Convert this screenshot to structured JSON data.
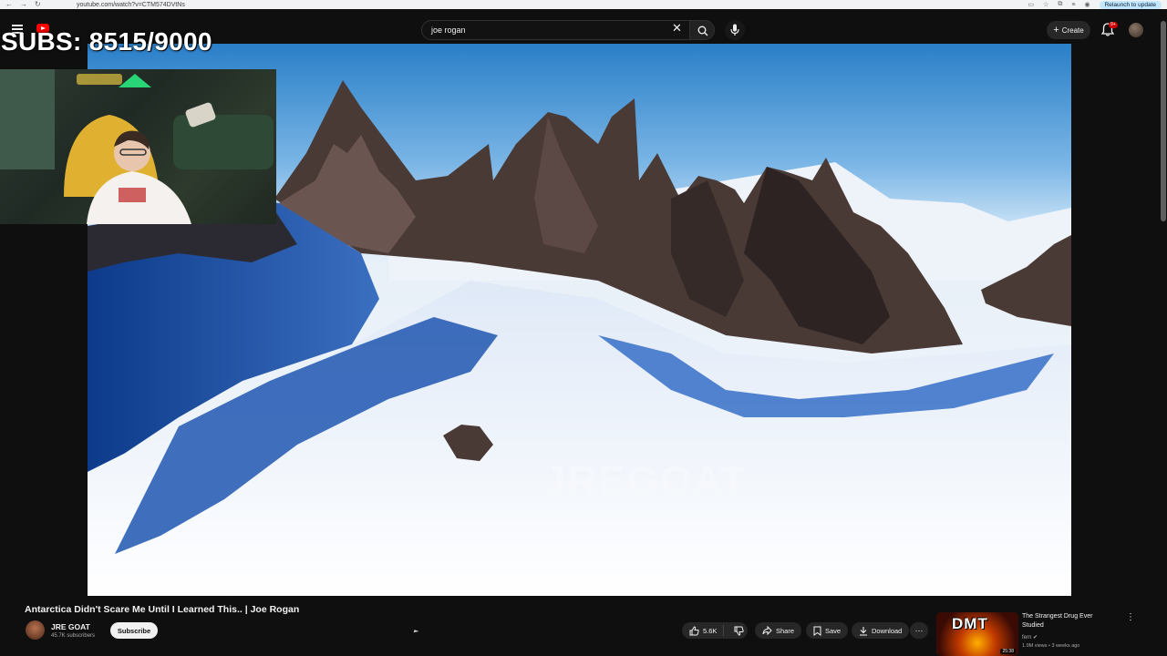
{
  "browser": {
    "url": "youtube.com/watch?v=CTM574DVtNs",
    "relaunch_label": "Relaunch to update"
  },
  "header": {
    "search_query": "joe rogan",
    "create_label": "Create",
    "notification_count": "9+"
  },
  "overlay": {
    "sub_counter": "SUBS: 8515/9000"
  },
  "video": {
    "watermark": "JREGOAT",
    "title": "Antarctica Didn't Scare Me Until I Learned This.. | Joe Rogan"
  },
  "channel": {
    "name": "JRE GOAT",
    "subscribers": "45.7K subscribers",
    "subscribe_label": "Subscribe"
  },
  "actions": {
    "likes": "5.6K",
    "share": "Share",
    "save": "Save",
    "download": "Download"
  },
  "recommended": {
    "thumb_text": "DMT",
    "duration": "25:38",
    "title": "The Strangest Drug Ever Studied",
    "channel": "fern",
    "meta": "1.9M views • 3 weeks ago"
  },
  "colors": {
    "background": "#0f0f0f",
    "subscribe_bg": "#f1f1f1",
    "badge_red": "#cc0000"
  }
}
